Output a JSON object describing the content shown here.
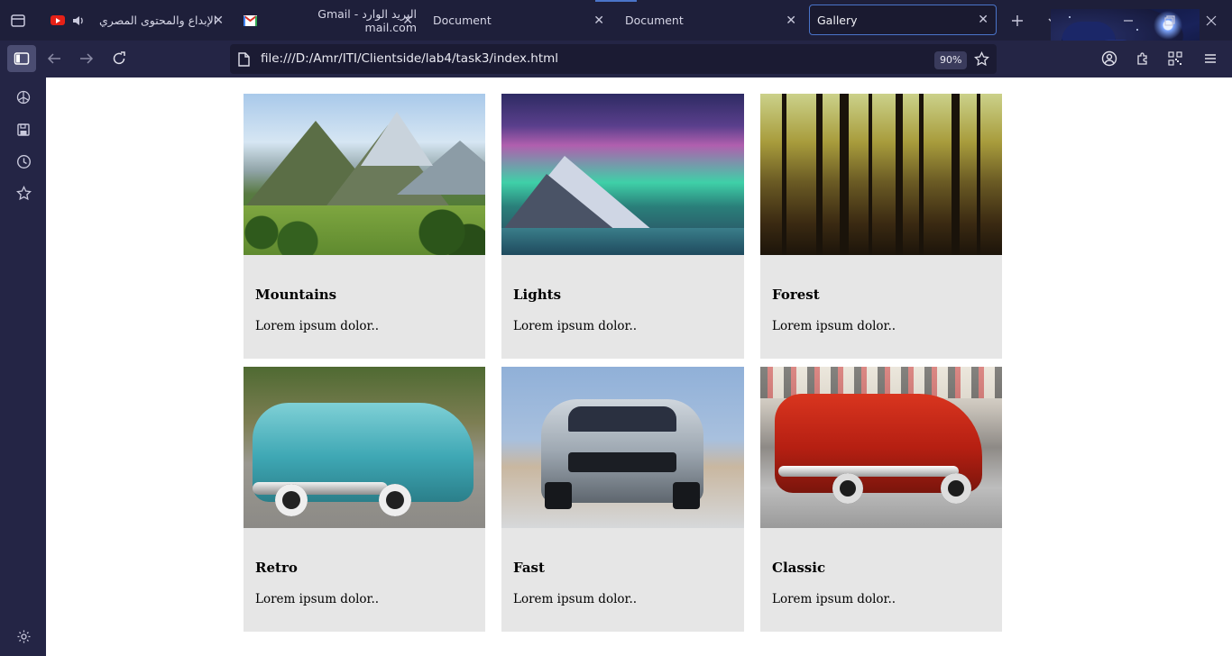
{
  "browser": {
    "tabs": [
      {
        "title": "الإبداع والمحتوى المصري",
        "icon": "youtube-icon",
        "audio": true
      },
      {
        "title": "البريد الوارد - Gmail mail.com",
        "icon": "gmail-icon"
      },
      {
        "title": "Document"
      },
      {
        "title": "Document"
      },
      {
        "title": "Gallery",
        "active": true
      }
    ],
    "url": "file:///D:/Amr/ITI/Clientside/lab4/task3/index.html",
    "zoom": "90%",
    "accent_color": "#4a74c9"
  },
  "sidebar": {
    "icons": [
      "chatgpt-icon",
      "save-icon",
      "history-icon",
      "bookmarks-star-icon",
      "settings-gear-icon"
    ]
  },
  "gallery": {
    "cards": [
      {
        "title": "Mountains",
        "text": "Lorem ipsum dolor.."
      },
      {
        "title": "Lights",
        "text": "Lorem ipsum dolor.."
      },
      {
        "title": "Forest",
        "text": "Lorem ipsum dolor.."
      },
      {
        "title": "Retro",
        "text": "Lorem ipsum dolor.."
      },
      {
        "title": "Fast",
        "text": "Lorem ipsum dolor.."
      },
      {
        "title": "Classic",
        "text": "Lorem ipsum dolor.."
      }
    ]
  }
}
